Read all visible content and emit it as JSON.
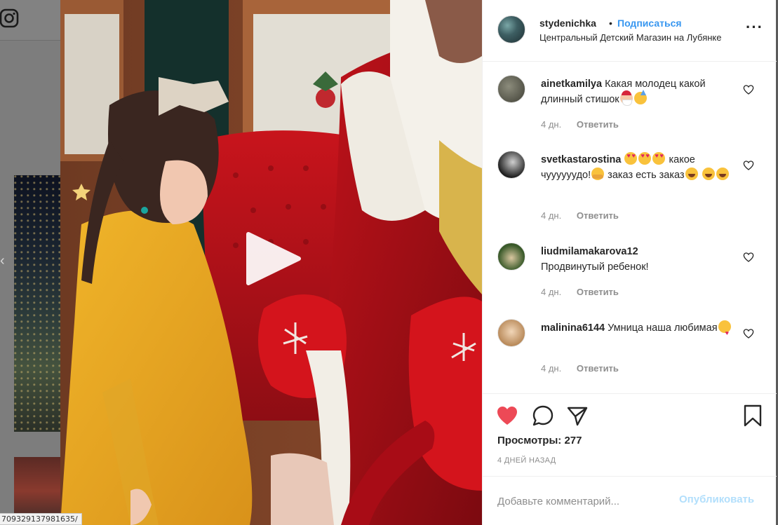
{
  "page": {
    "url_tooltip": "709329137981635/"
  },
  "post": {
    "username": "stydenichka",
    "separator": "•",
    "follow_label": "Подписаться",
    "location": "Центральный Детский Магазин на Лубянке",
    "more_icon": "more-horizontal-icon"
  },
  "comments": [
    {
      "username": "ainetkamilya",
      "text": "Какая молодец какой длинный стишок",
      "emojis_after": [
        "santa",
        "party"
      ],
      "time": "4 дн.",
      "reply_label": "Ответить"
    },
    {
      "username": "svetkastarostina",
      "parts": [
        "",
        " какое чуууууудо!",
        " заказ есть заказ",
        ""
      ],
      "emojis": [
        "heart-eyes",
        "heart-eyes",
        "heart-eyes",
        "hug",
        "laugh",
        "laugh",
        "laugh"
      ],
      "time": "4 дн.",
      "reply_label": "Ответить"
    },
    {
      "username": "liudmilamakarova12",
      "text": "Продвинутый ребенок!",
      "time": "4 дн.",
      "reply_label": "Ответить"
    },
    {
      "username": "malinina6144",
      "text": "Умница наша любимая",
      "emojis_after": [
        "kiss"
      ],
      "time": "4 дн.",
      "reply_label": "Ответить"
    }
  ],
  "actions": {
    "views_label": "Просмотры:",
    "views_count": "277",
    "date": "4 ДНЕЙ НАЗАД",
    "like_color": "#ed4956"
  },
  "add_comment": {
    "placeholder": "Добавьте комментарий...",
    "publish_label": "Опубликовать"
  },
  "colors": {
    "link": "#3897f0",
    "muted": "#8e8e8e",
    "text": "#262626"
  }
}
